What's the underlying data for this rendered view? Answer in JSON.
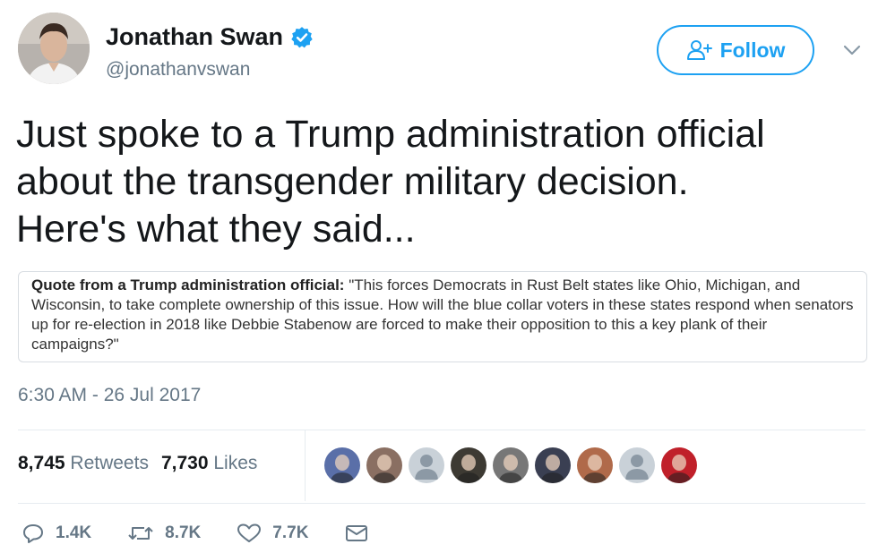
{
  "author": {
    "name": "Jonathan Swan",
    "handle": "@jonathanvswan",
    "verified_icon": "verified-badge-icon"
  },
  "follow_button": {
    "label": "Follow",
    "icon": "add-user-icon"
  },
  "menu": {
    "icon": "chevron-down-icon"
  },
  "tweet": {
    "text_line1": "Just spoke to a Trump administration official",
    "text_line2": "about the transgender military decision.",
    "text_line3": "Here's what they said..."
  },
  "quote": {
    "label": "Quote from a Trump administration official:",
    "body": " \"This forces Democrats in Rust Belt states like Ohio, Michigan, and Wisconsin, to take complete ownership of this issue. How will the blue collar voters in these states respond when senators up for re-election in 2018 like Debbie Stabenow are forced to make their opposition to this a key plank of their campaigns?\""
  },
  "timestamp": "6:30 AM - 26 Jul 2017",
  "stats": {
    "retweets_count": "8,745",
    "retweets_label": "Retweets",
    "likes_count": "7,730",
    "likes_label": "Likes"
  },
  "liker_avatars": [
    {
      "name": "eagle",
      "color": "#5a6fa8"
    },
    {
      "name": "person",
      "color": "#8a6f62"
    },
    {
      "name": "default",
      "color": "#c9d1d8"
    },
    {
      "name": "woman",
      "color": "#3d3a33"
    },
    {
      "name": "bw-portrait",
      "color": "#777777"
    },
    {
      "name": "group",
      "color": "#3a3f52"
    },
    {
      "name": "man",
      "color": "#b06a4a"
    },
    {
      "name": "default",
      "color": "#c9d1d8"
    },
    {
      "name": "red",
      "color": "#c0202a"
    }
  ],
  "actions": {
    "reply_count": "1.4K",
    "retweet_count": "8.7K",
    "like_count": "7.7K"
  },
  "colors": {
    "accent": "#1da1f2",
    "text": "#14171a",
    "muted": "#657786"
  }
}
